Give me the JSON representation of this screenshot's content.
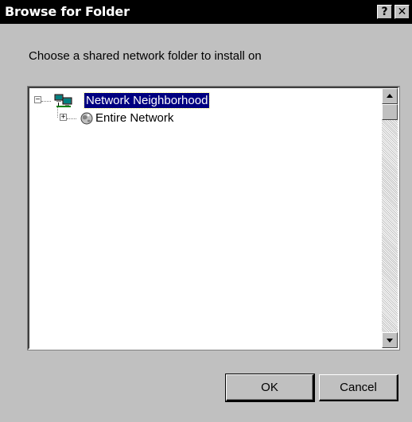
{
  "window": {
    "title": "Browse for Folder",
    "help_label": "?",
    "close_label": "✕"
  },
  "prompt": "Choose a shared network folder to install on",
  "tree": {
    "nodes": [
      {
        "label": "Network Neighborhood",
        "expander": "−",
        "icon": "network-neighborhood-icon",
        "selected": true
      },
      {
        "label": "Entire Network",
        "expander": "+",
        "icon": "entire-network-globe-icon",
        "selected": false
      }
    ]
  },
  "buttons": {
    "ok_label": "OK",
    "cancel_label": "Cancel"
  }
}
